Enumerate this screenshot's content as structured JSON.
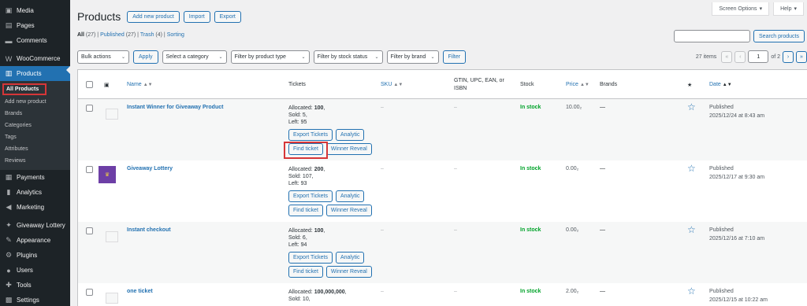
{
  "sidebar": {
    "items_top": [
      {
        "label": "Media",
        "icon": "media-icon",
        "glyph": "▣"
      },
      {
        "label": "Pages",
        "icon": "pages-icon",
        "glyph": "▤"
      },
      {
        "label": "Comments",
        "icon": "comments-icon",
        "glyph": "▬"
      }
    ],
    "woo": {
      "label": "WooCommerce",
      "icon": "woocommerce-icon",
      "glyph": "W"
    },
    "products": {
      "label": "Products",
      "icon": "products-icon",
      "glyph": "▥"
    },
    "submenu": [
      "All Products",
      "Add new product",
      "Brands",
      "Categories",
      "Tags",
      "Attributes",
      "Reviews"
    ],
    "items_bottom_1": [
      {
        "label": "Payments",
        "icon": "payments-icon",
        "glyph": "▦"
      },
      {
        "label": "Analytics",
        "icon": "analytics-icon",
        "glyph": "▮"
      },
      {
        "label": "Marketing",
        "icon": "marketing-icon",
        "glyph": "◀"
      }
    ],
    "items_bottom_2": [
      {
        "label": "Giveaway Lottery",
        "icon": "giveaway-icon",
        "glyph": "✦"
      },
      {
        "label": "Appearance",
        "icon": "appearance-icon",
        "glyph": "✎"
      },
      {
        "label": "Plugins",
        "icon": "plugins-icon",
        "glyph": "⚙"
      },
      {
        "label": "Users",
        "icon": "users-icon",
        "glyph": "●"
      },
      {
        "label": "Tools",
        "icon": "tools-icon",
        "glyph": "✚"
      },
      {
        "label": "Settings",
        "icon": "settings-icon",
        "glyph": "▩"
      }
    ]
  },
  "top_tabs": {
    "screen_options": "Screen Options",
    "help": "Help"
  },
  "header": {
    "title": "Products",
    "add_new": "Add new product",
    "import": "Import",
    "export": "Export"
  },
  "views": {
    "all": "All",
    "all_count": "(27)",
    "published": "Published",
    "published_count": "(27)",
    "trash": "Trash",
    "trash_count": "(4)",
    "sorting": "Sorting"
  },
  "search": {
    "button": "Search products",
    "value": ""
  },
  "filters": {
    "bulk": "Bulk actions",
    "apply": "Apply",
    "category": "Select a category",
    "type": "Filter by product type",
    "stock": "Filter by stock status",
    "brand": "Filter by brand",
    "filter": "Filter"
  },
  "pagination": {
    "items": "27 items",
    "first": "«",
    "prev": "‹",
    "current": "1",
    "of": "of 2",
    "next": "›",
    "last": "»"
  },
  "columns": {
    "name": "Name",
    "tickets": "Tickets",
    "sku": "SKU",
    "gtin": "GTIN, UPC, EAN, or ISBN",
    "stock": "Stock",
    "price": "Price",
    "brands": "Brands",
    "date": "Date"
  },
  "ticket_labels": {
    "allocated": "Allocated:",
    "sold": "Sold:",
    "left": "Left:",
    "export": "Export Tickets",
    "analytic": "Analytic",
    "find": "Find ticket",
    "reveal": "Winner Reveal"
  },
  "rows": [
    {
      "name": "Instant Winner for Giveaway Product",
      "allocated": "100",
      "sold": "5",
      "left": "95",
      "sku": "–",
      "gtin": "–",
      "stock": "In stock",
      "price": "10.00₂",
      "brands": "—",
      "status": "Published",
      "date": "2025/12/24 at 8:43 am"
    },
    {
      "name": "Giveaway Lottery",
      "allocated": "200",
      "sold": "107",
      "left": "93",
      "sku": "–",
      "gtin": "–",
      "stock": "In stock",
      "price": "0.00₂",
      "brands": "—",
      "status": "Published",
      "date": "2025/12/17 at 9:30 am"
    },
    {
      "name": "Instant checkout",
      "allocated": "100",
      "sold": "6",
      "left": "94",
      "sku": "–",
      "gtin": "–",
      "stock": "In stock",
      "price": "0.00₂",
      "brands": "—",
      "status": "Published",
      "date": "2025/12/16 at 7:10 am"
    },
    {
      "name": "one ticket",
      "allocated": "100,000,000",
      "sold": "10",
      "left": "",
      "sku": "–",
      "gtin": "–",
      "stock": "In stock",
      "price": "2.00₂",
      "brands": "—",
      "status": "Published",
      "date": "2025/12/15 at 10:22 am"
    }
  ],
  "colors": {
    "sidebar_bg": "#1d2327",
    "accent": "#2271b1",
    "instock": "#00a32a",
    "highlight": "#d63638"
  }
}
